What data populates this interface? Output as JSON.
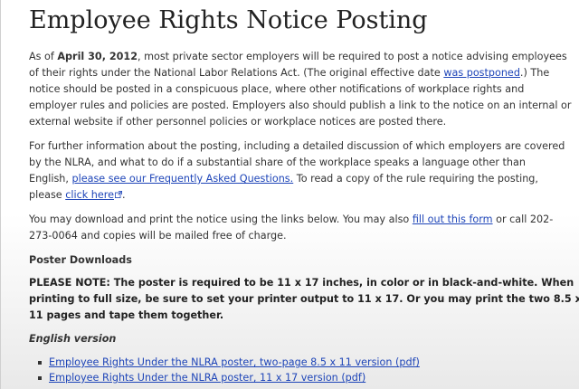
{
  "page": {
    "title": "Employee Rights Notice Posting"
  },
  "para1": {
    "t1": "As of ",
    "date": "April 30, 2012",
    "t2": ", most private sector employers will be required to post a notice advising employees",
    "line2a": "of their rights under the National Labor Relations Act. (The original effective date ",
    "link_postponed": "was postponed",
    "line2b": ".) The",
    "line3": "notice should be posted in a conspicuous place, where other notifications of workplace rights and",
    "line4": "employer rules and policies are posted. Employers also should publish a link to the notice on an internal or",
    "line5": "external website if other personnel policies or workplace notices are posted there."
  },
  "para2": {
    "line1": "For further information about the posting, including a detailed discussion of which employers are covered",
    "line2": "by the NLRA, and what to do if a substantial share of the workplace speaks a language other than",
    "line3a": "English, ",
    "link_faq": "please see our Frequently Asked Questions.",
    "line3b": " To read a copy of the rule requiring the posting,",
    "line4a": "please ",
    "link_click": "click here",
    "line4b": "."
  },
  "para3": {
    "line1a": "You may download and print the notice using the links below. You may also ",
    "link_form": "fill out this form",
    "line1b": " or call 202-",
    "line2": "273-0064 and copies will be mailed free of charge."
  },
  "downloads": {
    "heading": "Poster Downloads",
    "note_line1": "PLEASE NOTE: The poster is required to be 11 x 17 inches, in color or in black-and-white. When",
    "note_line2": "printing to full size, be sure to set your printer output to 11 x 17. Or you may print the two 8.5 x",
    "note_line3": "11 pages and tape them together.",
    "english_heading": "English version",
    "links": [
      "Employee Rights Under the NLRA poster, two-page 8.5 x 11 version (pdf)",
      "Employee Rights Under the NLRA poster, 11 x 17 version (pdf)"
    ]
  },
  "icons": {
    "external_link": "external-link-icon",
    "bullet": "square-bullet-icon"
  },
  "colors": {
    "link": "#1e45b8",
    "text": "#333333",
    "title": "#222222"
  }
}
